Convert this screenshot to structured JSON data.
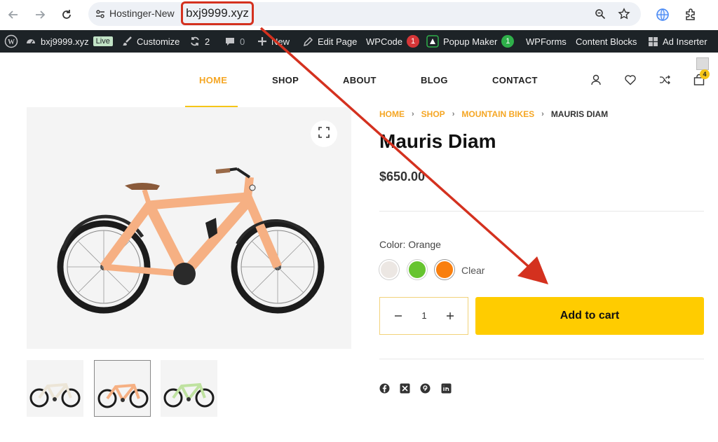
{
  "browser": {
    "site_name": "Hostinger-New",
    "url": "bxj9999.xyz",
    "icons": [
      "back-arrow-icon",
      "forward-arrow-icon",
      "reload-icon",
      "site-info-icon",
      "zoom-icon",
      "bookmark-star-icon",
      "translate-globe-icon",
      "extensions-icon"
    ]
  },
  "adminbar": {
    "site": "bxj9999.xyz",
    "live": "Live",
    "customize": "Customize",
    "updates_count": "2",
    "comments_count": "0",
    "new": "New",
    "edit_page": "Edit Page",
    "wpcode": "WPCode",
    "wpcode_badge": "1",
    "popup_maker": "Popup Maker",
    "popup_badge": "1",
    "wpforms": "WPForms",
    "content_blocks": "Content Blocks",
    "ad_inserter": "Ad Inserter",
    "colors": {
      "bar": "#1d2327",
      "badge_red": "#d63638",
      "badge_green": "#2fb04a"
    }
  },
  "menu": {
    "items": [
      "HOME",
      "SHOP",
      "ABOUT",
      "BLOG",
      "CONTACT"
    ],
    "active": "HOME",
    "cart_count": "4",
    "icons": [
      "account-icon",
      "wishlist-heart-icon",
      "compare-shuffle-icon",
      "cart-bag-icon"
    ]
  },
  "breadcrumb": [
    "HOME",
    "SHOP",
    "MOUNTAIN BIKES",
    "MAURIS DIAM"
  ],
  "product": {
    "title": "Mauris Diam",
    "price": "$650.00",
    "color_label": "Color: Orange",
    "swatches": [
      {
        "name": "cream",
        "color": "#ece7e3"
      },
      {
        "name": "green",
        "color": "#66c42f"
      },
      {
        "name": "orange",
        "color": "#f97f0e"
      }
    ],
    "selected_swatch": "orange",
    "clear": "Clear",
    "quantity": "1",
    "add_to_cart": "Add to cart",
    "bike_color": "#f6b083",
    "thumbnails": [
      {
        "name": "cream-bike",
        "color": "#ece5d7"
      },
      {
        "name": "orange-bike",
        "color": "#f6b083"
      },
      {
        "name": "green-bike",
        "color": "#bfe2a0"
      }
    ],
    "share_icons": [
      "facebook-icon",
      "x-twitter-icon",
      "pinterest-icon",
      "linkedin-icon"
    ]
  },
  "colors": {
    "accent": "#f5a623",
    "button": "#ffcc00",
    "annotation_red": "#d4311f"
  }
}
